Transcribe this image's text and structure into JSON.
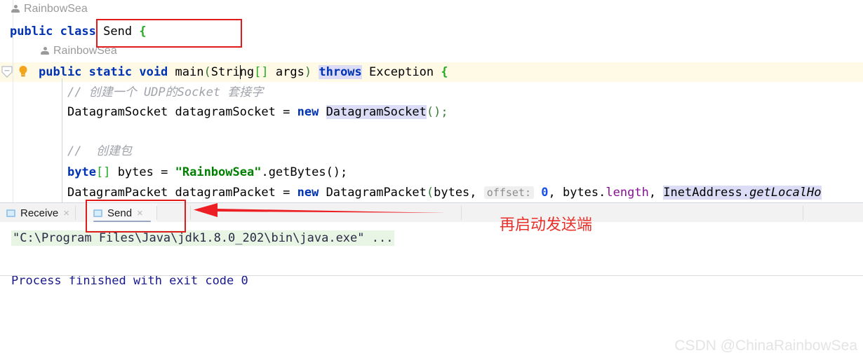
{
  "editor": {
    "breadcrumb": {
      "icon": "person-icon",
      "label": "RainbowSea"
    },
    "inlay_hint": {
      "icon": "person-icon",
      "label": "RainbowSea"
    },
    "gutter": {
      "fold_icon": "fold-collapse-icon",
      "bulb_icon": "lightbulb-icon"
    },
    "lines": {
      "class_decl": {
        "kw_public": "public",
        "kw_class": "class",
        "name": "Send",
        "brace": "{"
      },
      "main_method": {
        "kw_public": "public",
        "kw_static": "static",
        "kw_void": "void",
        "name": "main",
        "p_open": "(",
        "param_type": "String",
        "param_brackets": "[]",
        "param_name": "args",
        "p_close": ")",
        "kw_throws": "throws",
        "exception": "Exception",
        "brace": "{"
      },
      "comment_socket": "// 创建一个 UDP的Socket 套接字",
      "socket_stmt": {
        "type": "DatagramSocket",
        "var": "datagramSocket",
        "eq": "=",
        "kw_new": "new",
        "ctor": "DatagramSocket",
        "tail": "();"
      },
      "comment_packet": "//  创建包",
      "bytes_stmt": {
        "kw_byte": "byte",
        "brackets": "[]",
        "var": "bytes",
        "eq": "=",
        "string": "\"RainbowSea\"",
        "call": ".getBytes();"
      },
      "packet_stmt": {
        "type": "DatagramPacket",
        "var": "datagramPacket",
        "eq": "=",
        "kw_new": "new",
        "ctor": "DatagramPacket",
        "p_open": "(",
        "arg1": "bytes,",
        "inlay_label": "offset:",
        "arg2": "0",
        "arg3": ", bytes.",
        "arg3_field": "length",
        "arg4": ", ",
        "arg5_cls": "InetAddress",
        "arg5_dot": ".",
        "arg5_method": "getLocalHo"
      }
    }
  },
  "run_panel": {
    "tabs": [
      {
        "label": "Receive",
        "icon": "run-config-icon",
        "close": "×",
        "selected": false
      },
      {
        "label": "Send",
        "icon": "run-config-icon",
        "close": "×",
        "selected": true
      }
    ],
    "console": {
      "command_line": "\"C:\\Program Files\\Java\\jdk1.8.0_202\\bin\\java.exe\" ...",
      "exit_line": "Process finished with exit code 0"
    }
  },
  "annotations": {
    "red_box_class": {
      "name": "highlight-box-class-name"
    },
    "red_box_tab": {
      "name": "highlight-box-send-tab"
    },
    "arrow": {
      "name": "red-arrow-left",
      "color": "#e8302a"
    },
    "note_text": "再启动发送端",
    "note_color": "#e8302a"
  },
  "watermark": {
    "text": "CSDN @ChinaRainbowSea"
  },
  "colors": {
    "keyword": "#0033b3",
    "string": "#008000",
    "number": "#1750eb",
    "field": "#871094",
    "comment": "#a0a4aa",
    "selection": "#dcdcf7",
    "line_highlight": "#fffae6",
    "console_cmd_bg": "#e8f5e4",
    "console_text": "#1a1a8c",
    "annotation_red": "#e01b1b"
  }
}
